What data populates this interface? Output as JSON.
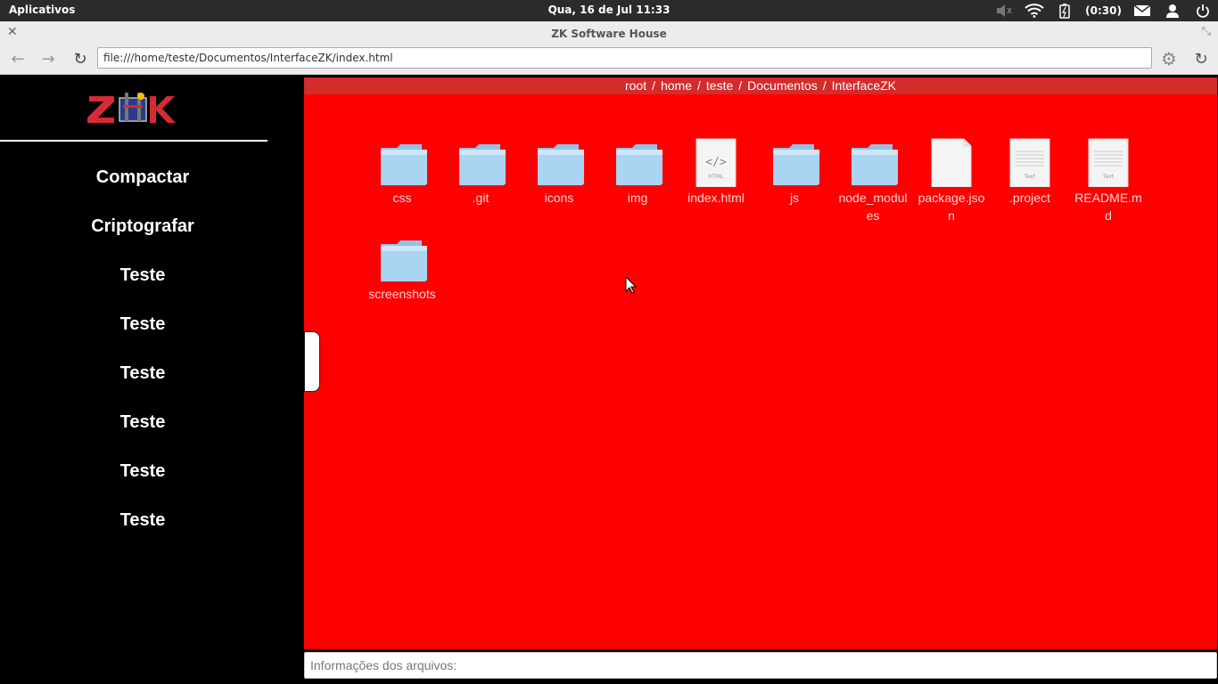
{
  "system_bar": {
    "apps_label": "Aplicativos",
    "clock": "Qua, 16 de Jul 11:33",
    "battery_text": "(0:30)",
    "icons": [
      "volume-muted-icon",
      "wifi-icon",
      "battery-icon",
      "mail-icon",
      "user-icon",
      "power-icon"
    ]
  },
  "browser": {
    "window_title": "ZK Software House",
    "url": "file:///home/teste/Documentos/InterfaceZK/index.html"
  },
  "sidebar": {
    "logo_text": "ZK",
    "items": [
      {
        "label": "Compactar"
      },
      {
        "label": "Criptografar"
      },
      {
        "label": "Teste"
      },
      {
        "label": "Teste"
      },
      {
        "label": "Teste"
      },
      {
        "label": "Teste"
      },
      {
        "label": "Teste"
      },
      {
        "label": "Teste"
      }
    ]
  },
  "breadcrumb": [
    "root",
    "home",
    "teste",
    "Documentos",
    "InterfaceZK"
  ],
  "files": [
    {
      "name": "css",
      "type": "folder"
    },
    {
      "name": ".git",
      "type": "folder"
    },
    {
      "name": "icons",
      "type": "folder"
    },
    {
      "name": "img",
      "type": "folder"
    },
    {
      "name": "index.html",
      "type": "html"
    },
    {
      "name": "js",
      "type": "folder"
    },
    {
      "name": "node_modules",
      "type": "folder"
    },
    {
      "name": "package.json",
      "type": "blank"
    },
    {
      "name": ".project",
      "type": "text"
    },
    {
      "name": "README.md",
      "type": "text"
    },
    {
      "name": "screenshots",
      "type": "folder"
    }
  ],
  "html_icon_caption": "HTML",
  "text_icon_caption": "Text",
  "info_placeholder": "Informações dos arquivos:",
  "colors": {
    "main_bg": "#ff0000",
    "breadcrumb_bg": "#d42b2b",
    "sidebar_bg": "#000000"
  }
}
